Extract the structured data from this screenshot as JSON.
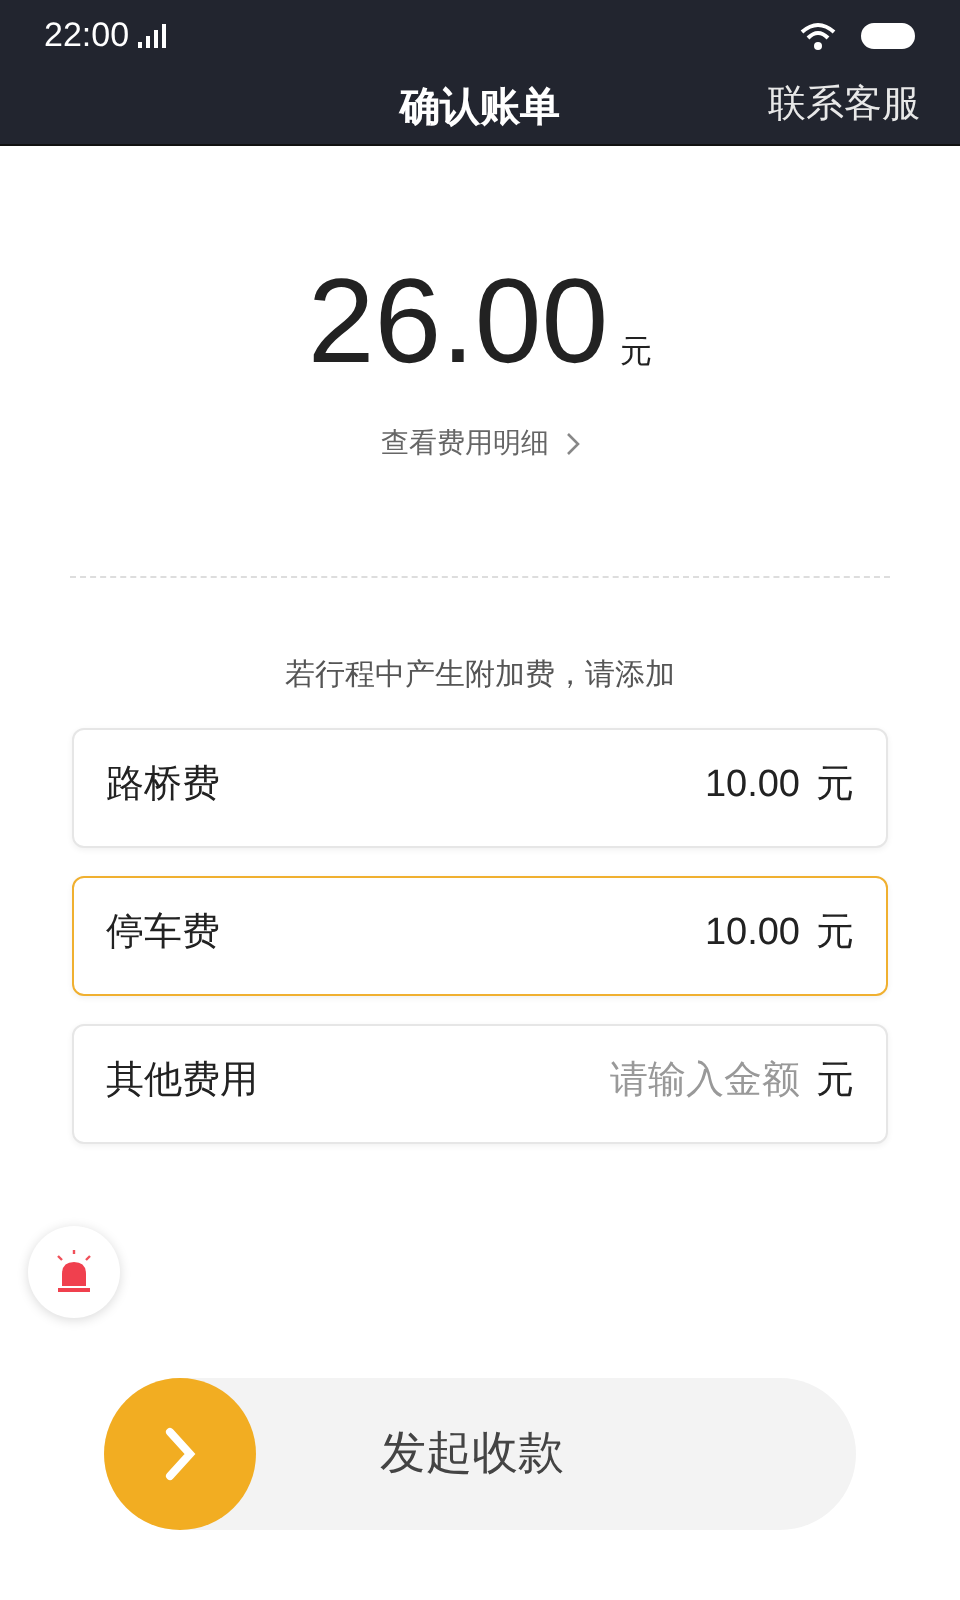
{
  "status_bar": {
    "time": "22:00"
  },
  "header": {
    "title": "确认账单",
    "action": "联系客服"
  },
  "total": {
    "amount": "26.00",
    "unit": "元",
    "detail_link": "查看费用明细"
  },
  "extra_fees": {
    "hint": "若行程中产生附加费，请添加",
    "items": [
      {
        "label": "路桥费",
        "value": "10.00",
        "unit": "元",
        "selected": false
      },
      {
        "label": "停车费",
        "value": "10.00",
        "unit": "元",
        "selected": true
      },
      {
        "label": "其他费用",
        "placeholder": "请输入金额",
        "unit": "元",
        "selected": false
      }
    ]
  },
  "slide_button": {
    "label": "发起收款"
  }
}
